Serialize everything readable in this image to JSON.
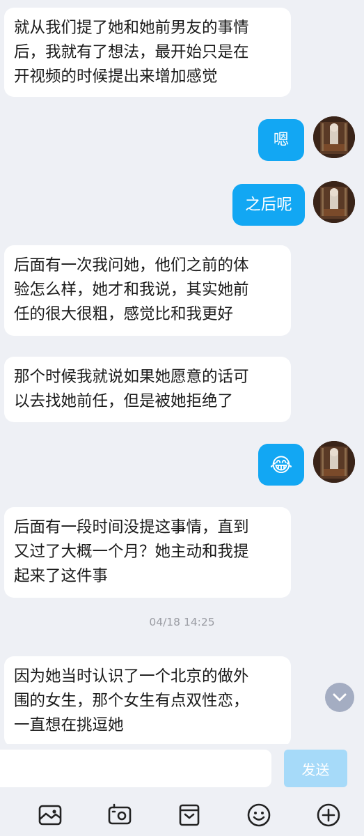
{
  "messages": [
    {
      "side": "left",
      "text": "就从我们提了她和她前男友的事情\n后，我就有了想法，最开始只是在\n开视频的时候提出来增加感觉"
    },
    {
      "side": "right",
      "text": "嗯"
    },
    {
      "side": "right",
      "text": "之后呢"
    },
    {
      "side": "left",
      "text": "后面有一次我问她，他们之前的体\n验怎么样，她才和我说，其实她前\n任的很大很粗，感觉比和我更好"
    },
    {
      "side": "left",
      "text": "那个时候我就说如果她愿意的话可\n以去找她前任，但是被她拒绝了"
    },
    {
      "side": "right",
      "text": "😂"
    },
    {
      "side": "left",
      "text": "后面有一段时间没提这事情，直到\n又过了大概一个月？她主动和我提\n起来了这件事"
    },
    {
      "side": "left",
      "text": "因为她当时认识了一个北京的做外\n围的女生，那个女生有点双性恋，\n一直想在挑逗她"
    }
  ],
  "timestamp": "04/18 14:25",
  "input": {
    "value": "",
    "send_label": "发送"
  },
  "toolbar": [
    "image-icon",
    "camera-icon",
    "favorites-icon",
    "emoji-icon",
    "plus-icon"
  ],
  "colors": {
    "background": "#eef0f5",
    "bubble_self": "#12a7f3",
    "bubble_other": "#ffffff",
    "send_disabled": "#a6daf9"
  }
}
